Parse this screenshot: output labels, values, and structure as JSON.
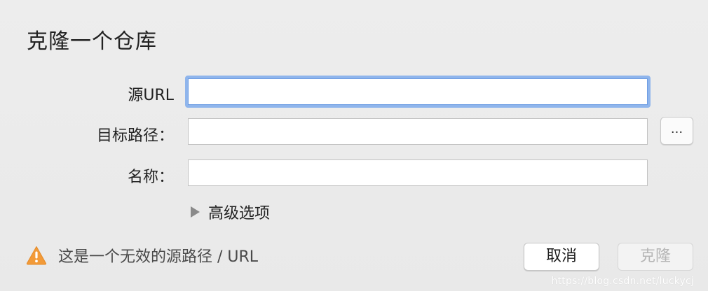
{
  "dialog": {
    "title": "克隆一个仓库",
    "fields": {
      "source_url": {
        "label": "源URL",
        "value": "",
        "placeholder": ""
      },
      "target_path": {
        "label": "目标路径：",
        "value": "",
        "placeholder": ""
      },
      "name": {
        "label": "名称：",
        "value": "",
        "placeholder": ""
      }
    },
    "browse_button_label": "...",
    "advanced_options_label": "高级选项",
    "warning_message": "这是一个无效的源路径 / URL",
    "buttons": {
      "cancel": "取消",
      "clone": "克隆"
    }
  },
  "watermark": "https://blog.csdn.net/luckycj",
  "colors": {
    "focus_ring": "#8fb5ec",
    "warning_icon": "#f29a38",
    "background": "#ececec",
    "disabled_text": "#b5b5b5"
  },
  "icons": {
    "warning": "warning-triangle-icon",
    "disclosure": "disclosure-triangle-icon"
  }
}
